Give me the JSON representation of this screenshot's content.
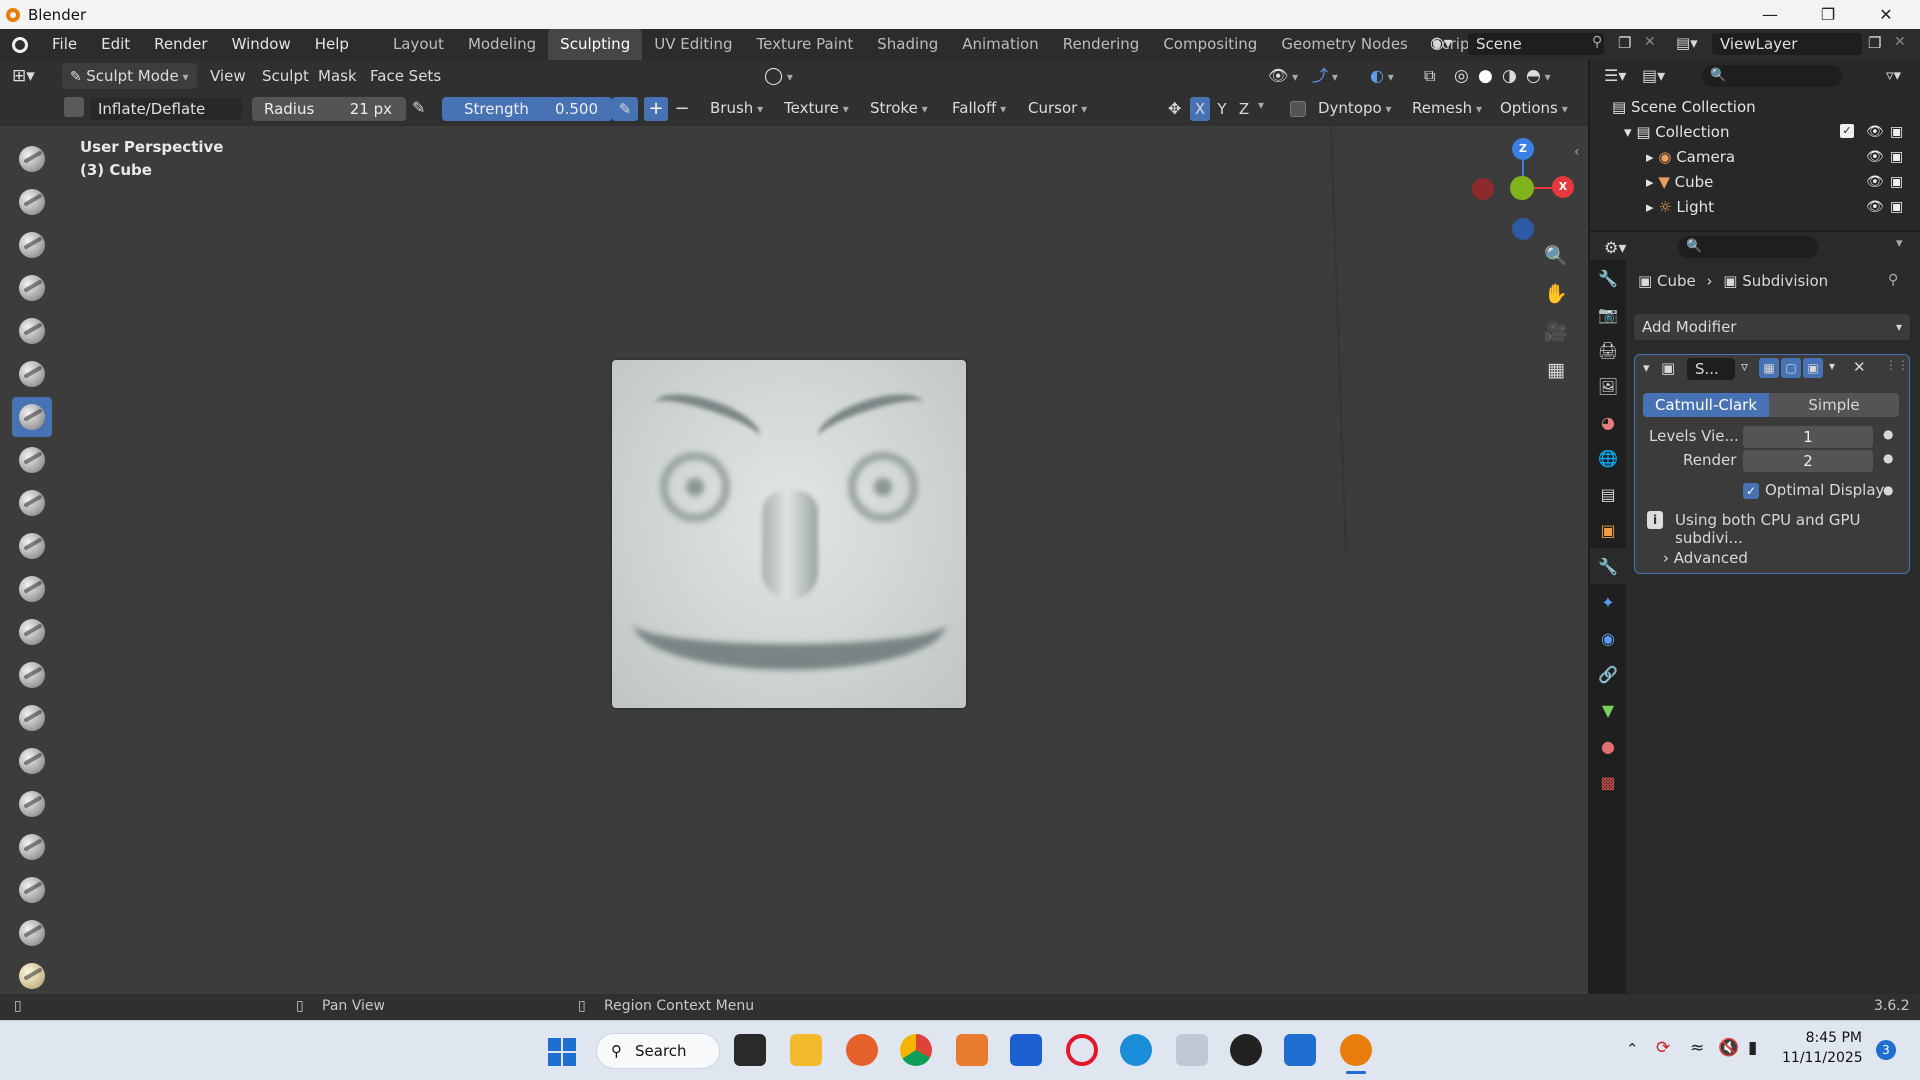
{
  "window": {
    "title": "Blender"
  },
  "menus": [
    "File",
    "Edit",
    "Render",
    "Window",
    "Help"
  ],
  "workspaces": [
    "Layout",
    "Modeling",
    "Sculpting",
    "UV Editing",
    "Texture Paint",
    "Shading",
    "Animation",
    "Rendering",
    "Compositing",
    "Geometry Nodes",
    "Scripting"
  ],
  "active_workspace": "Sculpting",
  "scene": {
    "label": "Scene",
    "viewlayer": "ViewLayer"
  },
  "header": {
    "mode": "Sculpt Mode",
    "menus": [
      "View",
      "Sculpt",
      "Mask",
      "Face Sets"
    ]
  },
  "brush_bar": {
    "brush_name": "Inflate/Deflate",
    "radius_label": "Radius",
    "radius_value": "21 px",
    "strength_label": "Strength",
    "strength_value": "0.500",
    "plus": "+",
    "minus": "−",
    "dropdowns": [
      "Brush",
      "Texture",
      "Stroke",
      "Falloff",
      "Cursor"
    ],
    "axes": [
      "X",
      "Y",
      "Z"
    ],
    "dyntopo": "Dyntopo",
    "remesh": "Remesh",
    "options": "Options"
  },
  "viewport": {
    "perspective": "User Perspective",
    "object": "(3) Cube"
  },
  "gizmo": {
    "z": "Z",
    "x": "X"
  },
  "outliner": {
    "root": "Scene Collection",
    "collection": "Collection",
    "items": [
      "Camera",
      "Cube",
      "Light"
    ]
  },
  "properties": {
    "breadcrumb_object": "Cube",
    "breadcrumb_modifier": "Subdivision",
    "add_modifier": "Add Modifier",
    "modifier_name": "S...",
    "tabs": [
      "Catmull-Clark",
      "Simple"
    ],
    "active_tab": "Catmull-Clark",
    "levels_label": "Levels Vie...",
    "levels_value": "1",
    "render_label": "Render",
    "render_value": "2",
    "optimal_display": "Optimal Display",
    "optimal_checked": true,
    "info": "Using both CPU and GPU subdivi...",
    "advanced": "Advanced"
  },
  "statusbar": {
    "pan": "Pan View",
    "context": "Region Context Menu",
    "version": "3.6.2"
  },
  "taskbar": {
    "search": "Search",
    "time": "8:45 PM",
    "date": "11/11/2025",
    "notifications": "3"
  }
}
